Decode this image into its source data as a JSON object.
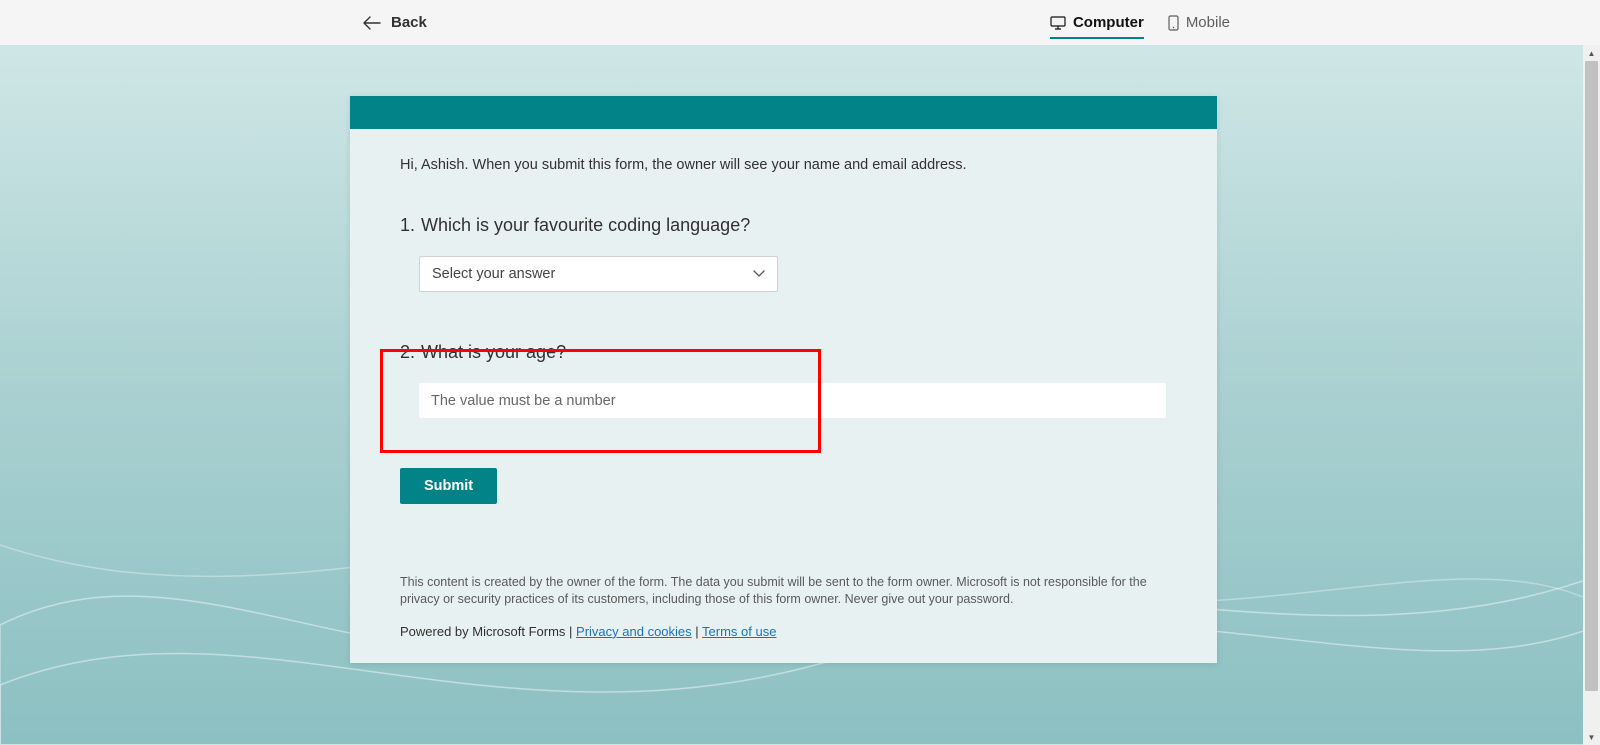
{
  "topbar": {
    "back_label": "Back",
    "tabs": {
      "computer": "Computer",
      "mobile": "Mobile"
    }
  },
  "form": {
    "intro": "Hi, Ashish. When you submit this form, the owner will see your name and email address.",
    "q1": {
      "number": "1.",
      "text": "Which is your favourite coding language?",
      "placeholder": "Select your answer"
    },
    "q2": {
      "number": "2.",
      "text": "What is your age?",
      "placeholder": "The value must be a number"
    },
    "submit_label": "Submit"
  },
  "footer": {
    "disclaimer": "This content is created by the owner of the form. The data you submit will be sent to the form owner. Microsoft is not responsible for the privacy or security practices of its customers, including those of this form owner. Never give out your password.",
    "powered_by": "Powered by Microsoft Forms",
    "sep": " | ",
    "privacy": "Privacy and cookies",
    "terms": "Terms of use"
  }
}
